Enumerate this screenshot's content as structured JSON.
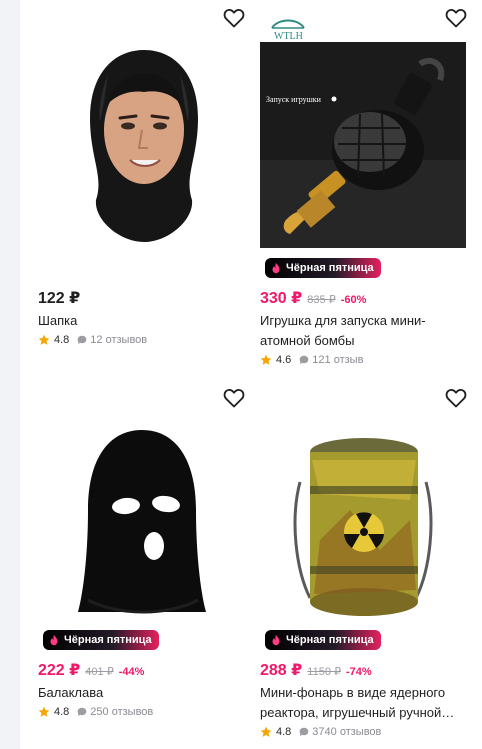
{
  "products": [
    {
      "title": "Шапка",
      "price": "122 ₽",
      "rating": "4.8",
      "reviews": "12 отзывов"
    },
    {
      "badge": "Чёрная пятница",
      "price": "330 ₽",
      "old_price": "835 ₽",
      "discount": "-60%",
      "title": "Игрушка для запуска мини-атомной бомбы",
      "rating": "4.6",
      "reviews": "121 отзыв",
      "image_brand": "WTLH",
      "image_caption": "Запуск игрушки"
    },
    {
      "badge": "Чёрная пятница",
      "price": "222 ₽",
      "old_price": "401 ₽",
      "discount": "-44%",
      "title": "Балаклава",
      "rating": "4.8",
      "reviews": "250 отзывов"
    },
    {
      "badge": "Чёрная пятница",
      "price": "288 ₽",
      "old_price": "1150 ₽",
      "discount": "-74%",
      "title": "Мини-фонарь в виде ядерного реактора, игрушечный ручной…",
      "rating": "4.8",
      "reviews": "3740 отзывов"
    }
  ],
  "colors": {
    "sale": "#f0186a",
    "star": "#f7a600",
    "muted": "#9c9ca3"
  },
  "icons": [
    "heart-icon",
    "flame-icon",
    "star-icon",
    "speech-bubble-icon"
  ]
}
